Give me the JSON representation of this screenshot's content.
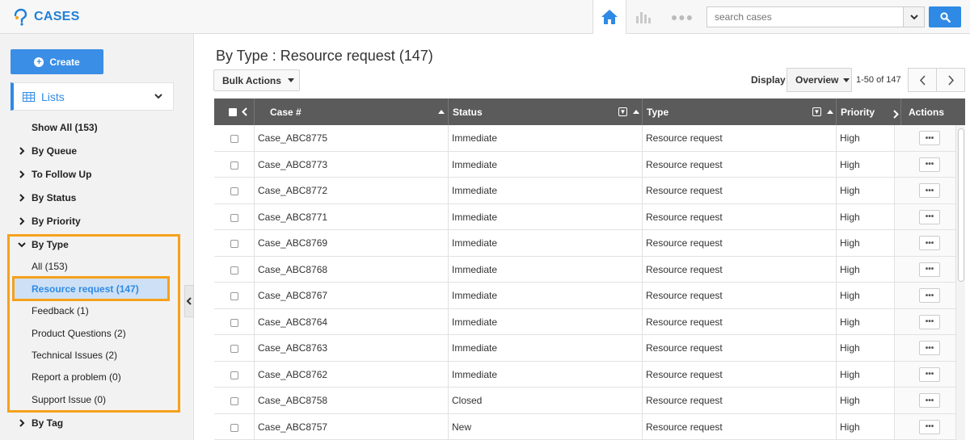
{
  "header": {
    "app_title": "CASES",
    "search_placeholder": "search cases"
  },
  "sidebar": {
    "create_label": "Create",
    "lists_label": "Lists",
    "show_all": "Show All (153)",
    "groups": [
      {
        "label": "By Queue"
      },
      {
        "label": "To Follow Up"
      },
      {
        "label": "By Status"
      },
      {
        "label": "By Priority"
      },
      {
        "label": "By Type"
      },
      {
        "label": "By Tag"
      }
    ],
    "type_items": [
      {
        "label": "All  (153)"
      },
      {
        "label": "Resource request  (147)"
      },
      {
        "label": "Feedback  (1)"
      },
      {
        "label": "Product Questions  (2)"
      },
      {
        "label": "Technical Issues  (2)"
      },
      {
        "label": "Report a problem  (0)"
      },
      {
        "label": "Support Issue  (0)"
      }
    ]
  },
  "main": {
    "title": "By Type : Resource request (147)",
    "bulk_actions": "Bulk Actions",
    "display_label": "Display",
    "display_value": "Overview",
    "range": "1-50 of 147",
    "columns": {
      "case": "Case #",
      "status": "Status",
      "type": "Type",
      "priority": "Priority",
      "actions": "Actions"
    },
    "rows": [
      {
        "case": "Case_ABC8775",
        "status": "Immediate",
        "type": "Resource request",
        "priority": "High"
      },
      {
        "case": "Case_ABC8773",
        "status": "Immediate",
        "type": "Resource request",
        "priority": "High"
      },
      {
        "case": "Case_ABC8772",
        "status": "Immediate",
        "type": "Resource request",
        "priority": "High"
      },
      {
        "case": "Case_ABC8771",
        "status": "Immediate",
        "type": "Resource request",
        "priority": "High"
      },
      {
        "case": "Case_ABC8769",
        "status": "Immediate",
        "type": "Resource request",
        "priority": "High"
      },
      {
        "case": "Case_ABC8768",
        "status": "Immediate",
        "type": "Resource request",
        "priority": "High"
      },
      {
        "case": "Case_ABC8767",
        "status": "Immediate",
        "type": "Resource request",
        "priority": "High"
      },
      {
        "case": "Case_ABC8764",
        "status": "Immediate",
        "type": "Resource request",
        "priority": "High"
      },
      {
        "case": "Case_ABC8763",
        "status": "Immediate",
        "type": "Resource request",
        "priority": "High"
      },
      {
        "case": "Case_ABC8762",
        "status": "Immediate",
        "type": "Resource request",
        "priority": "High"
      },
      {
        "case": "Case_ABC8758",
        "status": "Closed",
        "type": "Resource request",
        "priority": "High"
      },
      {
        "case": "Case_ABC8757",
        "status": "New",
        "type": "Resource request",
        "priority": "High"
      }
    ],
    "action_glyph": "•••"
  },
  "colors": {
    "accent": "#2f8ae5",
    "highlight": "#f5a11c",
    "header_bg": "#5b5b5b"
  }
}
